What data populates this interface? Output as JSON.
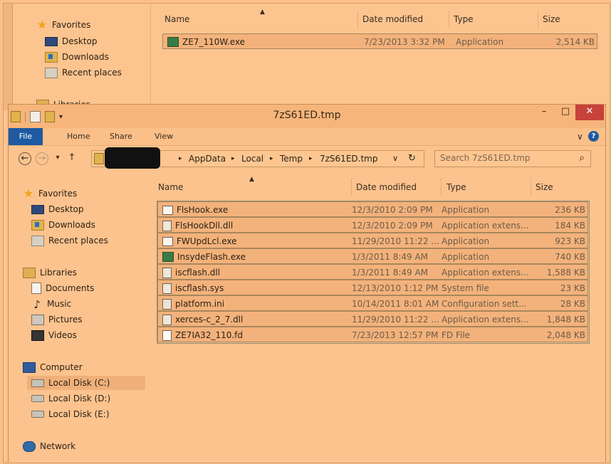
{
  "back_window": {
    "nav": [
      {
        "label": "Favorites",
        "icon": "star-icon"
      },
      {
        "label": "Desktop",
        "icon": "desktop-icon"
      },
      {
        "label": "Downloads",
        "icon": "downloads-icon"
      },
      {
        "label": "Recent places",
        "icon": "recent-places-icon"
      },
      {
        "label": "Libraries",
        "icon": "libraries-icon"
      }
    ],
    "columns": {
      "name": "Name",
      "date": "Date modified",
      "type": "Type",
      "size": "Size"
    },
    "files": [
      {
        "name": "ZE7_110W.exe",
        "date": "7/23/2013 3:32 PM",
        "type": "Application",
        "size": "2,514 KB",
        "icon": "exe-icon"
      }
    ]
  },
  "window": {
    "title": "7zS61ED.tmp",
    "controls": {
      "minimize": "–",
      "maximize": "□",
      "close": "✕"
    },
    "ribbon_tabs": [
      "File",
      "Home",
      "Share",
      "View"
    ],
    "ribbon_right": {
      "expand": "∨",
      "help": "?"
    },
    "nav_buttons": {
      "back": "←",
      "forward": "→",
      "recent": "▾",
      "up": "↑"
    },
    "breadcrumb": [
      "AppData",
      "Local",
      "Temp",
      "7zS61ED.tmp"
    ],
    "breadcrumb_separator": "▸",
    "address_dropdown": "∨",
    "refresh": "↻",
    "search_placeholder": "Search 7zS61ED.tmp",
    "search_icon": "⌕"
  },
  "nav_pane": [
    {
      "label": "Favorites",
      "icon": "star-icon",
      "group": true
    },
    {
      "label": "Desktop",
      "icon": "desktop-icon"
    },
    {
      "label": "Downloads",
      "icon": "downloads-icon"
    },
    {
      "label": "Recent places",
      "icon": "recent-places-icon"
    },
    {
      "label": "Libraries",
      "icon": "libraries-icon",
      "group": true
    },
    {
      "label": "Documents",
      "icon": "documents-icon"
    },
    {
      "label": "Music",
      "icon": "music-icon"
    },
    {
      "label": "Pictures",
      "icon": "pictures-icon"
    },
    {
      "label": "Videos",
      "icon": "videos-icon"
    },
    {
      "label": "Computer",
      "icon": "computer-icon",
      "group": true
    },
    {
      "label": "Local Disk (C:)",
      "icon": "system-drive-icon",
      "selected": true
    },
    {
      "label": "Local Disk (D:)",
      "icon": "drive-icon"
    },
    {
      "label": "Local Disk (E:)",
      "icon": "drive-icon"
    },
    {
      "label": "Network",
      "icon": "network-icon",
      "group": true
    }
  ],
  "columns": {
    "name": "Name",
    "date": "Date modified",
    "type": "Type",
    "size": "Size"
  },
  "files": [
    {
      "name": "FlsHook.exe",
      "date": "12/3/2010 2:09 PM",
      "type": "Application",
      "size": "236 KB",
      "icon": "app-window-icon"
    },
    {
      "name": "FlsHookDll.dll",
      "date": "12/3/2010 2:09 PM",
      "type": "Application extens...",
      "size": "184 KB",
      "icon": "dll-gear-icon"
    },
    {
      "name": "FWUpdLcl.exe",
      "date": "11/29/2010 11:22 ...",
      "type": "Application",
      "size": "923 KB",
      "icon": "app-window-icon"
    },
    {
      "name": "InsydeFlash.exe",
      "date": "1/3/2011 8:49 AM",
      "type": "Application",
      "size": "740 KB",
      "icon": "flash-exe-icon"
    },
    {
      "name": "iscflash.dll",
      "date": "1/3/2011 8:49 AM",
      "type": "Application extens...",
      "size": "1,588 KB",
      "icon": "dll-gear-icon"
    },
    {
      "name": "iscflash.sys",
      "date": "12/13/2010 1:12 PM",
      "type": "System file",
      "size": "23 KB",
      "icon": "sys-gear-icon"
    },
    {
      "name": "platform.ini",
      "date": "10/14/2011 8:01 AM",
      "type": "Configuration sett...",
      "size": "28 KB",
      "icon": "ini-file-icon"
    },
    {
      "name": "xerces-c_2_7.dll",
      "date": "11/29/2010 11:22 ...",
      "type": "Application extens...",
      "size": "1,848 KB",
      "icon": "dll-gear-icon"
    },
    {
      "name": "ZE7IA32_110.fd",
      "date": "7/23/2013 12:57 PM",
      "type": "FD File",
      "size": "2,048 KB",
      "icon": "blank-file-icon"
    }
  ]
}
